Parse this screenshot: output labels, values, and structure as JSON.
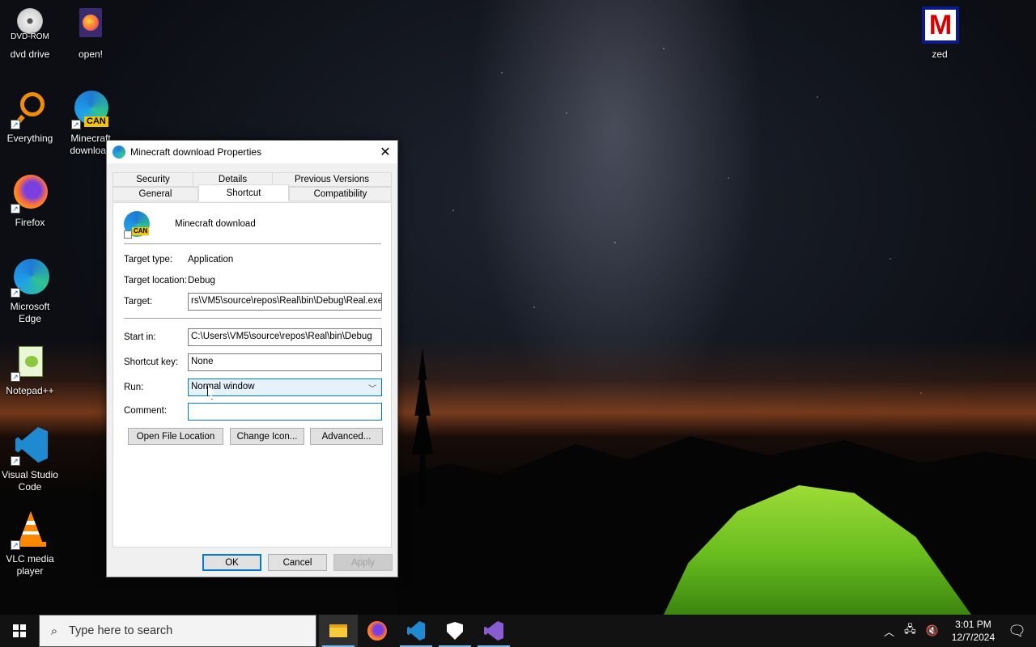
{
  "desktop": {
    "icons": [
      {
        "label": "dvd drive",
        "badge": "DVD-ROM",
        "icon": "dvd-drive-icon"
      },
      {
        "label": "open!",
        "icon": "firefox-file-icon"
      },
      {
        "label": "Everything",
        "icon": "everything-search-icon"
      },
      {
        "label": "Minecraft download",
        "badge": "CAN",
        "icon": "edge-can-shortcut-icon"
      },
      {
        "label": "Firefox",
        "icon": "firefox-icon"
      },
      {
        "label": "Microsoft Edge",
        "icon": "edge-icon"
      },
      {
        "label": "Notepad++",
        "icon": "notepadpp-icon"
      },
      {
        "label": "Visual Studio Code",
        "icon": "vscode-icon"
      },
      {
        "label": "VLC media player",
        "icon": "vlc-icon"
      },
      {
        "label": "zed",
        "badge": "M",
        "icon": "zed-icon"
      }
    ]
  },
  "dialog": {
    "title": "Minecraft download Properties",
    "close_glyph": "✕",
    "tabs": {
      "security": "Security",
      "details": "Details",
      "previous_versions": "Previous Versions",
      "general": "General",
      "shortcut": "Shortcut",
      "compatibility": "Compatibility"
    },
    "active_tab": "Shortcut",
    "shortcut_name": "Minecraft download",
    "icon_badge": "CAN",
    "target_type_label": "Target type:",
    "target_type_value": "Application",
    "target_location_label": "Target location:",
    "target_location_value": "Debug",
    "target_label": "Target:",
    "target_value": "rs\\VM5\\source\\repos\\Real\\bin\\Debug\\Real.exe",
    "start_in_label": "Start in:",
    "start_in_value": "C:\\Users\\VM5\\source\\repos\\Real\\bin\\Debug",
    "shortcut_key_label": "Shortcut key:",
    "shortcut_key_value": "None",
    "run_label": "Run:",
    "run_value": "Normal window",
    "comment_label": "Comment:",
    "comment_value": "",
    "open_file_location": "Open File Location",
    "change_icon": "Change Icon...",
    "advanced": "Advanced...",
    "ok": "OK",
    "cancel": "Cancel",
    "apply": "Apply"
  },
  "taskbar": {
    "search_placeholder": "Type here to search",
    "apps": [
      "file-explorer-icon",
      "firefox-icon",
      "vscode-icon",
      "security-icon",
      "visual-studio-icon"
    ],
    "time": "3:01 PM",
    "date": "12/7/2024"
  },
  "colors": {
    "accent": "#0078d7",
    "dialog_bg": "#f0f0f0",
    "taskbar_bg": "#121212"
  }
}
